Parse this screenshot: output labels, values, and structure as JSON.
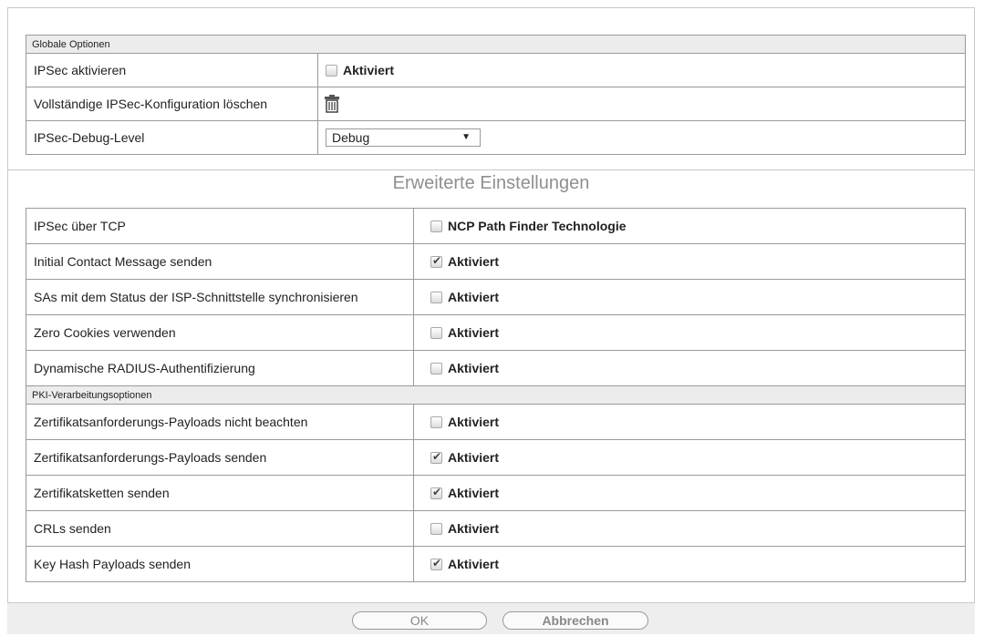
{
  "global": {
    "header": "Globale Optionen",
    "rows": [
      {
        "label": "IPSec aktivieren",
        "checkbox_label": "Aktiviert",
        "checked": false
      },
      {
        "label": "Vollständige IPSec-Konfiguration löschen",
        "icon": "trash-icon"
      },
      {
        "label": "IPSec-Debug-Level",
        "select_value": "Debug"
      }
    ]
  },
  "advanced": {
    "title": "Erweiterte Einstellungen",
    "rows": [
      {
        "label": "IPSec über TCP",
        "checkbox_label": "NCP Path Finder Technologie",
        "checked": false
      },
      {
        "label": "Initial Contact Message senden",
        "checkbox_label": "Aktiviert",
        "checked": true
      },
      {
        "label": "SAs mit dem Status der ISP-Schnittstelle synchronisieren",
        "checkbox_label": "Aktiviert",
        "checked": false
      },
      {
        "label": "Zero Cookies verwenden",
        "checkbox_label": "Aktiviert",
        "checked": false
      },
      {
        "label": "Dynamische RADIUS-Authentifizierung",
        "checkbox_label": "Aktiviert",
        "checked": false
      }
    ],
    "pki_header": "PKI-Verarbeitungsoptionen",
    "pki_rows": [
      {
        "label": "Zertifikatsanforderungs-Payloads nicht beachten",
        "checkbox_label": "Aktiviert",
        "checked": false
      },
      {
        "label": "Zertifikatsanforderungs-Payloads senden",
        "checkbox_label": "Aktiviert",
        "checked": true
      },
      {
        "label": "Zertifikatsketten senden",
        "checkbox_label": "Aktiviert",
        "checked": true
      },
      {
        "label": "CRLs senden",
        "checkbox_label": "Aktiviert",
        "checked": false
      },
      {
        "label": "Key Hash Payloads senden",
        "checkbox_label": "Aktiviert",
        "checked": true
      }
    ]
  },
  "footer": {
    "ok_label": "OK",
    "cancel_label": "Abbrechen"
  }
}
